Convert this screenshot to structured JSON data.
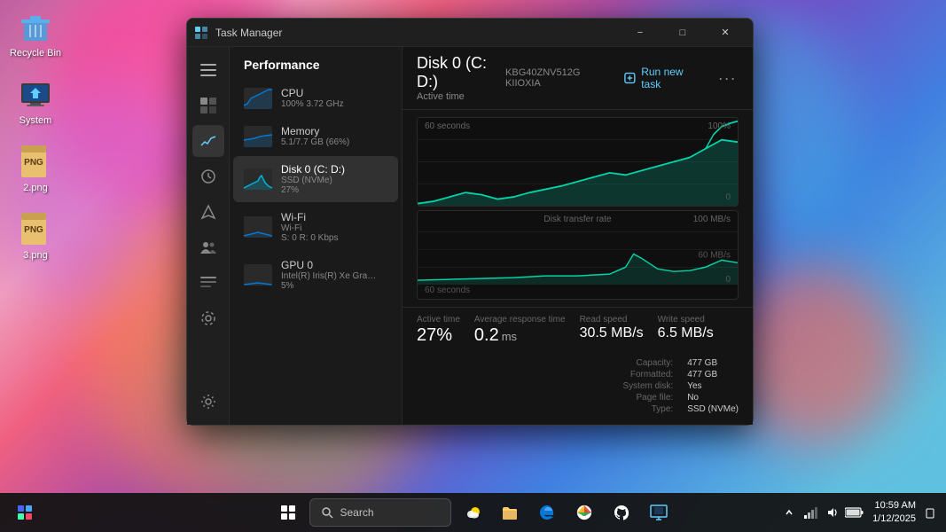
{
  "desktop": {
    "icons": [
      {
        "id": "recycle-bin",
        "label": "Recycle Bin"
      },
      {
        "id": "system",
        "label": "System"
      },
      {
        "id": "2png",
        "label": "2.png"
      },
      {
        "id": "3png",
        "label": "3.png"
      }
    ]
  },
  "taskmanager": {
    "title": "Task Manager",
    "titlebar": {
      "minimize": "−",
      "maximize": "□",
      "close": "✕"
    },
    "sidebar_section": "Performance",
    "nav": {
      "items": [
        {
          "id": "cpu",
          "title": "CPU",
          "sub": "100%  3.72 GHz",
          "value": 100
        },
        {
          "id": "memory",
          "title": "Memory",
          "sub": "5.1/7.7 GB (66%)",
          "value": 66
        },
        {
          "id": "disk0",
          "title": "Disk 0 (C: D:)",
          "sub": "SSD (NVMe)\n27%",
          "value": 27,
          "selected": true
        },
        {
          "id": "wifi",
          "title": "Wi-Fi",
          "sub": "Wi-Fi\nS: 0 R: 0 Kbps",
          "value": 30
        },
        {
          "id": "gpu0",
          "title": "GPU 0",
          "sub": "Intel(R) Iris(R) Xe Gra…\n5%",
          "value": 5
        }
      ]
    },
    "main": {
      "title": "Disk 0 (C: D:)",
      "active_time_label": "Active time",
      "disk_model": "KBG40ZNV512G KIIOXIA",
      "run_new_task": "Run new task",
      "chart1": {
        "time_label": "60 seconds",
        "top_right": "100%",
        "bottom_right": "0"
      },
      "chart2": {
        "title": "Disk transfer rate",
        "top_right": "100 MB/s",
        "mid_right": "60 MB/s",
        "bottom_right": "0",
        "time_label": "60 seconds"
      },
      "stats": {
        "active_time_label": "Active time",
        "active_time_value": "27%",
        "avg_response_label": "Average response time",
        "avg_response_value": "0.2",
        "avg_response_unit": "ms",
        "read_speed_label": "Read speed",
        "read_speed_value": "30.5 MB/s",
        "write_speed_label": "Write speed",
        "write_speed_value": "6.5 MB/s"
      },
      "info": {
        "capacity_label": "Capacity:",
        "capacity_value": "477 GB",
        "formatted_label": "Formatted:",
        "formatted_value": "477 GB",
        "system_disk_label": "System disk:",
        "system_disk_value": "Yes",
        "page_file_label": "Page file:",
        "page_file_value": "No",
        "type_label": "Type:",
        "type_value": "SSD (NVMe)"
      }
    }
  },
  "taskbar": {
    "search_placeholder": "Search",
    "time": "10:59 AM",
    "date": "1/12/2025"
  }
}
